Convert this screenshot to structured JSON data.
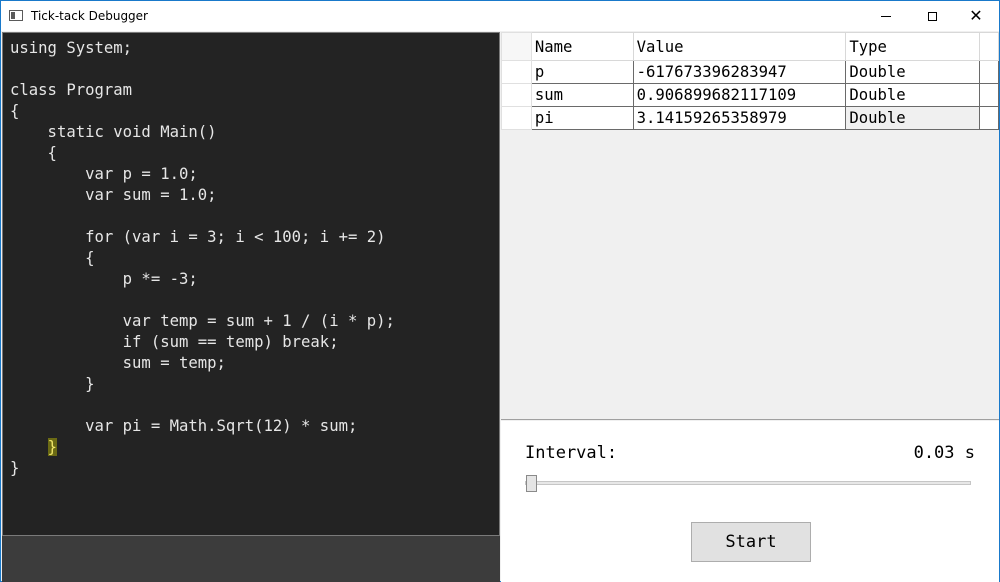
{
  "window": {
    "title": "Tick-tack Debugger"
  },
  "code": {
    "lines": [
      "using System;",
      "",
      "class Program",
      "{",
      "    static void Main()",
      "    {",
      "        var p = 1.0;",
      "        var sum = 1.0;",
      "",
      "        for (var i = 3; i < 100; i += 2)",
      "        {",
      "            p *= -3;",
      "",
      "            var temp = sum + 1 / (i * p);",
      "            if (sum == temp) break;",
      "            sum = temp;",
      "        }",
      "",
      "        var pi = Math.Sqrt(12) * sum;",
      "    }",
      "}"
    ],
    "highlight": {
      "line": 20,
      "indent": "    ",
      "text": "}"
    }
  },
  "variables": {
    "headers": {
      "name": "Name",
      "value": "Value",
      "type": "Type"
    },
    "rows": [
      {
        "name": "p",
        "value": "-617673396283947",
        "type": "Double"
      },
      {
        "name": "sum",
        "value": "0.906899682117109",
        "type": "Double"
      },
      {
        "name": "pi",
        "value": "3.14159265358979",
        "type": "Double"
      }
    ]
  },
  "controls": {
    "interval_label": "Interval:",
    "interval_value": "0.03 s",
    "slider_fraction": 0.0,
    "start_label": "Start"
  },
  "icons": {
    "app": "app-window-icon",
    "minimize": "minimize-icon",
    "maximize": "maximize-icon",
    "close": "close-icon"
  }
}
